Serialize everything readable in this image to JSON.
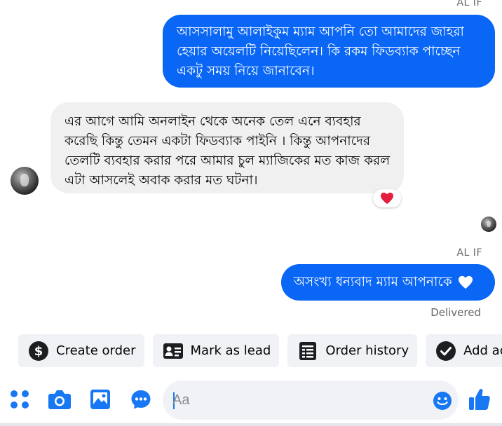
{
  "conversation": {
    "sender_top_label": "AL IF",
    "messages": [
      {
        "side": "outgoing",
        "text": "আসসালামু আলাইকুম ম্যাম আপনি তো আমাদের জাহরা হেয়ার অয়েলটি নিয়েছিলেন। কি রকম ফিডব্যাক পাচ্ছেন একটু সময় নিয়ে জানাবেন।"
      },
      {
        "side": "incoming",
        "text": "এর আগে আমি অনলাইন থেকে অনেক তেল এনে ব্যবহার করেছি কিন্তু তেমন একটা ফিডব্যাক পাইনি । কিন্তু আপনাদের তেলটি ব্যবহার করার পরে আমার চুল ম্যাজিকের মত কাজ করল এটা আসলেই অবাক করার মত ঘটনা।",
        "reaction": "heart"
      },
      {
        "side": "outgoing",
        "sender_label": "AL IF",
        "text": "অসংখ্য ধন্যবাদ ম্যাম আপনাকে",
        "trailing_icon": "white-heart"
      }
    ],
    "status": "Delivered"
  },
  "quick_actions": [
    {
      "label": "Create order",
      "icon": "dollar-icon"
    },
    {
      "label": "Mark as lead",
      "icon": "contact-card-icon"
    },
    {
      "label": "Order history",
      "icon": "receipt-icon"
    },
    {
      "label": "Add activi",
      "icon": "check-circle-icon"
    }
  ],
  "composer": {
    "placeholder": "Aa",
    "icons": [
      "apps-icon",
      "camera-icon",
      "gallery-icon",
      "chat-bubble-icon",
      "emoji-icon",
      "thumbs-up-icon"
    ]
  },
  "colors": {
    "outgoing_bubble": "#0a66f5",
    "incoming_bubble": "#f0f0f0",
    "accent": "#1877f2",
    "reaction_heart": "#e41e3f"
  }
}
